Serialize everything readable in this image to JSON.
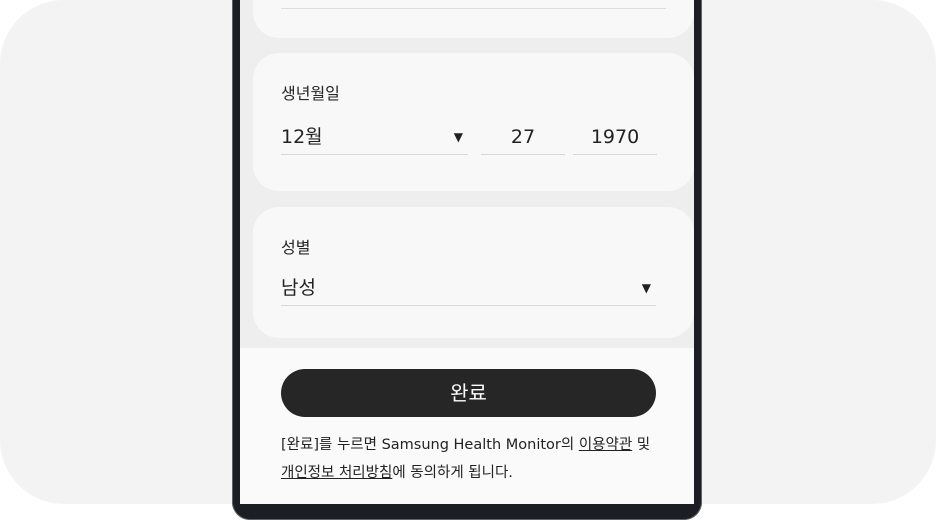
{
  "dob": {
    "label": "생년월일",
    "month": "12월",
    "day": "27",
    "year": "1970"
  },
  "gender": {
    "label": "성별",
    "value": "남성"
  },
  "done_button": "완료",
  "terms": {
    "prefix": "[완료]를 누르면 Samsung Health Monitor의 ",
    "terms_link": "이용약관",
    "middle": " 및 ",
    "privacy_link": "개인정보 처리방침",
    "suffix": "에 동의하게 됩니다."
  },
  "icons": {
    "dropdown": "caret-down-icon"
  }
}
